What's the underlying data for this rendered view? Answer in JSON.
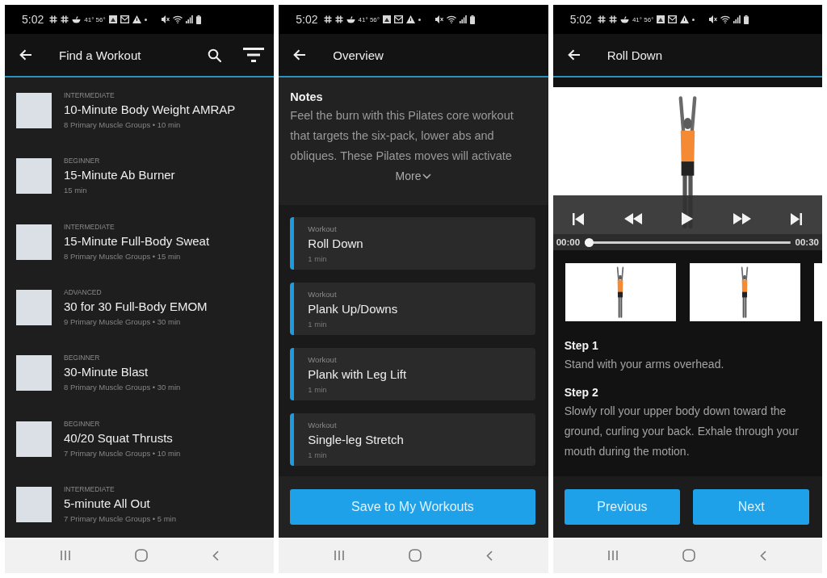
{
  "screens": [
    {
      "kind": "workout_list",
      "status_bar": {
        "time": "5:02",
        "temperature": "41° 56°"
      },
      "app_bar": {
        "title": "Find a Workout"
      },
      "workouts": [
        {
          "difficulty": "INTERMEDIATE",
          "title": "10-Minute Body Weight AMRAP",
          "details": "8 Primary Muscle Groups • 10 min"
        },
        {
          "difficulty": "BEGINNER",
          "title": "15-Minute Ab Burner",
          "details": "15 min"
        },
        {
          "difficulty": "INTERMEDIATE",
          "title": "15-Minute Full-Body Sweat",
          "details": "8 Primary Muscle Groups • 15 min"
        },
        {
          "difficulty": "ADVANCED",
          "title": "30 for 30 Full-Body EMOM",
          "details": "9 Primary Muscle Groups • 30 min"
        },
        {
          "difficulty": "BEGINNER",
          "title": "30-Minute Blast",
          "details": "8 Primary Muscle Groups • 30 min"
        },
        {
          "difficulty": "BEGINNER",
          "title": "40/20 Squat Thrusts",
          "details": "7 Primary Muscle Groups • 10 min"
        },
        {
          "difficulty": "INTERMEDIATE",
          "title": "5-minute All Out",
          "details": "7 Primary Muscle Groups • 5 min"
        }
      ]
    },
    {
      "kind": "overview",
      "status_bar": {
        "time": "5:02",
        "temperature": "41° 56°"
      },
      "app_bar": {
        "title": "Overview"
      },
      "notes": {
        "heading": "Notes",
        "text": "Feel the burn with this Pilates core workout that targets the six-pack, lower abs and obliques. These Pilates moves will activate",
        "more": "More"
      },
      "exercises": [
        {
          "label": "Workout",
          "title": "Roll Down",
          "duration": "1 min"
        },
        {
          "label": "Workout",
          "title": "Plank Up/Downs",
          "duration": "1 min"
        },
        {
          "label": "Workout",
          "title": "Plank with Leg Lift",
          "duration": "1 min"
        },
        {
          "label": "Workout",
          "title": "Single-leg Stretch",
          "duration": "1 min"
        }
      ],
      "save_button": "Save to My Workouts"
    },
    {
      "kind": "exercise",
      "status_bar": {
        "time": "5:02",
        "temperature": "41° 56°"
      },
      "app_bar": {
        "title": "Roll Down"
      },
      "player": {
        "elapsed": "00:00",
        "duration": "00:30",
        "level": 0
      },
      "steps": [
        {
          "heading": "Step 1",
          "text": "Stand with your arms overhead."
        },
        {
          "heading": "Step 2",
          "text": "Slowly roll your upper body down toward the ground, curling your back. Exhale through your mouth during the motion."
        }
      ],
      "buttons": [
        "Previous",
        "Next"
      ]
    }
  ]
}
